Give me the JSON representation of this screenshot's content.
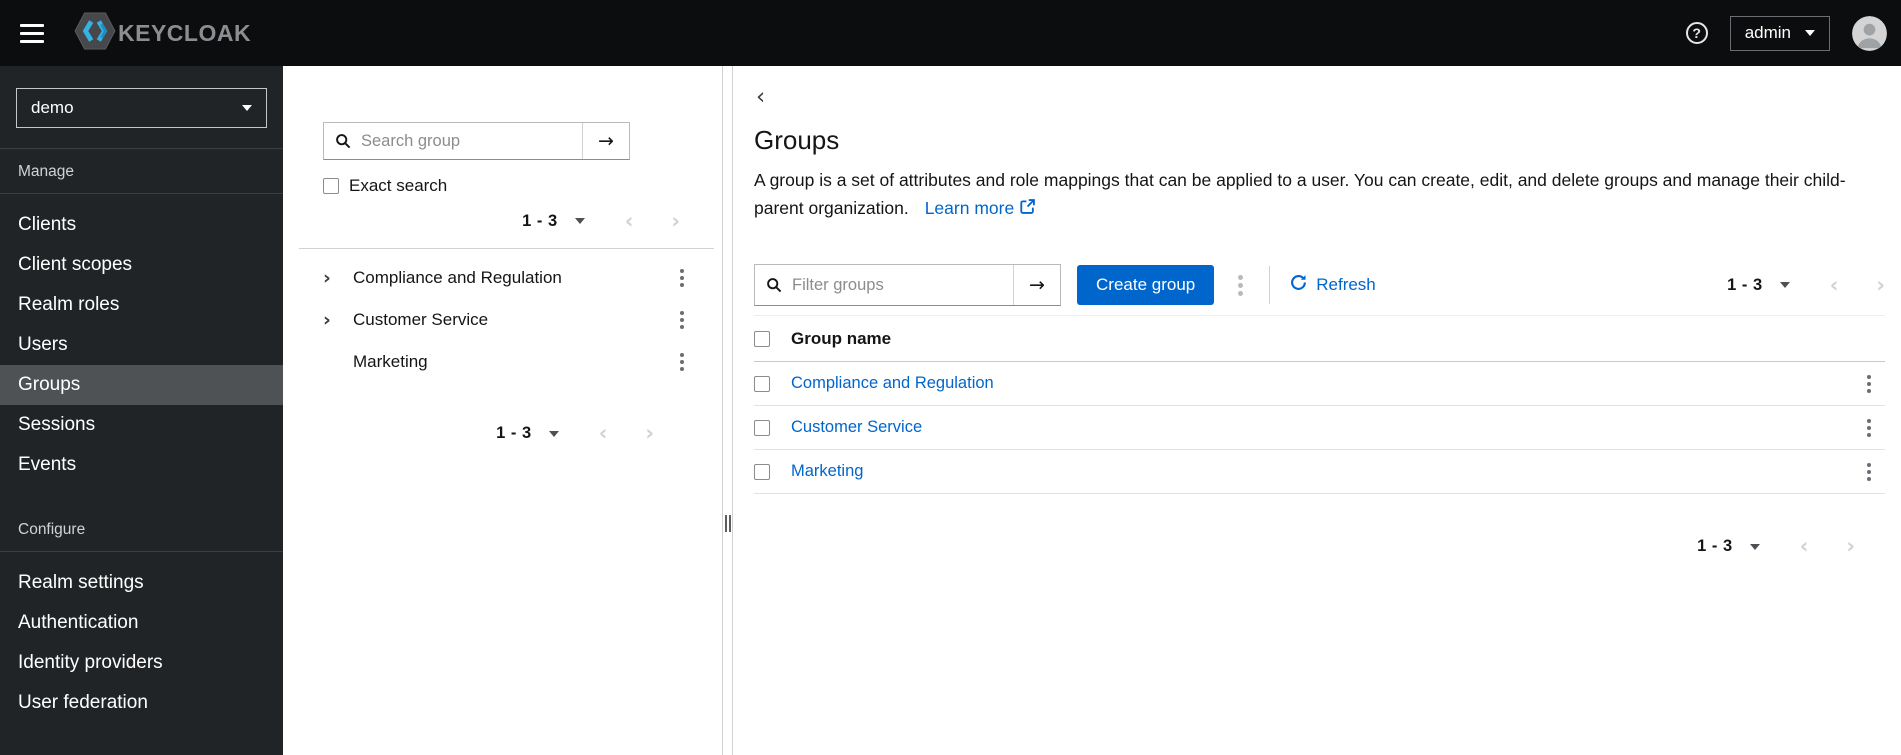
{
  "header": {
    "brand": "KEYCLOAK",
    "user": "admin"
  },
  "icons": {
    "help_glyph": "?",
    "arrow_right": "→",
    "chevron_left": "‹",
    "chevron_right": "›",
    "tree_expand": "›",
    "back": "‹"
  },
  "sidebar": {
    "realm": "demo",
    "sections": [
      {
        "label": "Manage",
        "items": [
          {
            "label": "Clients"
          },
          {
            "label": "Client scopes"
          },
          {
            "label": "Realm roles"
          },
          {
            "label": "Users"
          },
          {
            "label": "Groups",
            "selected": true
          },
          {
            "label": "Sessions"
          },
          {
            "label": "Events"
          }
        ]
      },
      {
        "label": "Configure",
        "items": [
          {
            "label": "Realm settings"
          },
          {
            "label": "Authentication"
          },
          {
            "label": "Identity providers"
          },
          {
            "label": "User federation"
          }
        ]
      }
    ]
  },
  "drawer": {
    "search_placeholder": "Search group",
    "exact_search_label": "Exact search",
    "pagination_top": {
      "range": "1 - 3"
    },
    "tree": [
      {
        "label": "Compliance and Regulation",
        "expandable": true
      },
      {
        "label": "Customer Service",
        "expandable": true
      },
      {
        "label": "Marketing",
        "expandable": false
      }
    ],
    "pagination_bottom": {
      "range": "1 - 3"
    }
  },
  "main": {
    "title": "Groups",
    "description": "A group is a set of attributes and role mappings that can be applied to a user. You can create, edit, and delete groups and manage their child-parent organization.",
    "learn_more_label": "Learn more",
    "toolbar": {
      "filter_placeholder": "Filter groups",
      "create_button_label": "Create group",
      "refresh_label": "Refresh",
      "pagination": {
        "range": "1 - 3"
      }
    },
    "table": {
      "columns": [
        "Group name"
      ],
      "rows": [
        {
          "name": "Compliance and Regulation"
        },
        {
          "name": "Customer Service"
        },
        {
          "name": "Marketing"
        }
      ]
    },
    "pagination_bottom": {
      "range": "1 - 3"
    }
  },
  "colors": {
    "accent": "#0066cc",
    "link": "#0066cc",
    "masthead_bg": "#0c0d0e",
    "sidebar_bg": "#212427",
    "sidebar_selected_bg": "#4f5255",
    "text": "#151515",
    "muted": "#6a6e73",
    "border": "#d2d2d2",
    "logo_cyan": "#36b3e0"
  }
}
